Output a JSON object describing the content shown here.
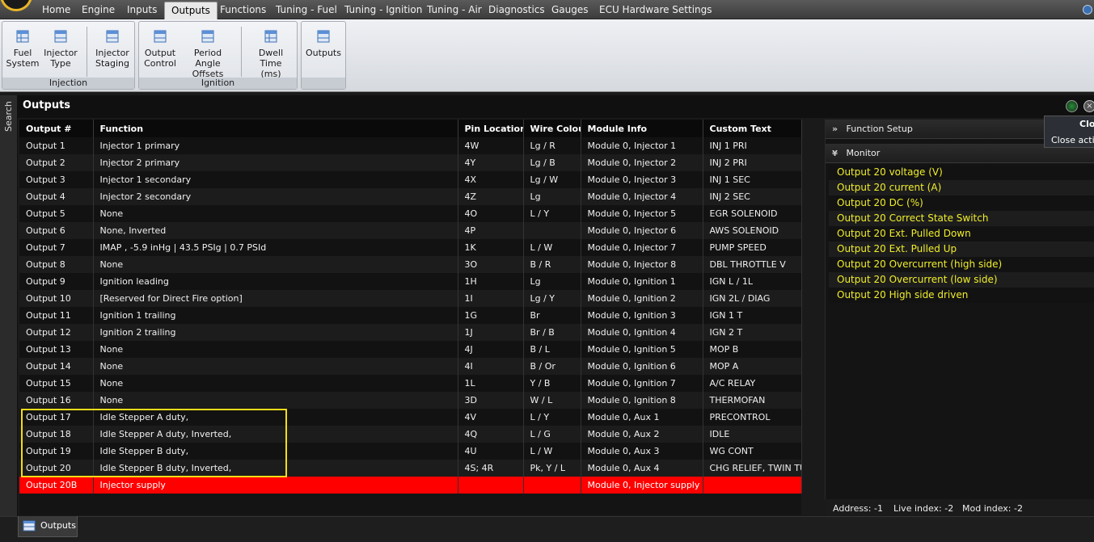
{
  "menu": {
    "items": [
      "Home",
      "Engine",
      "Inputs",
      "Outputs",
      "Functions",
      "Tuning - Fuel",
      "Tuning - Ignition",
      "Tuning - Air",
      "Diagnostics",
      "Gauges",
      "ECU Hardware Settings"
    ],
    "active": "Outputs"
  },
  "ribbon": {
    "injection": {
      "label": "Injection",
      "buttons": [
        {
          "line1": "Fuel",
          "line2": "System"
        },
        {
          "line1": "Injector",
          "line2": "Type"
        },
        {
          "line1": "Injector",
          "line2": "Staging"
        }
      ]
    },
    "ignition": {
      "label": "Ignition",
      "buttons": [
        {
          "line1": "Output",
          "line2": "Control"
        },
        {
          "line1": "Period Angle",
          "line2": "Offsets"
        },
        {
          "line1": "Dwell Time",
          "line2": "(ms)"
        }
      ]
    },
    "outputs": {
      "label": "",
      "button": "Outputs"
    }
  },
  "sidebar": {
    "search_label": "Search"
  },
  "panel": {
    "title": "Outputs"
  },
  "table": {
    "headers": [
      "Output #",
      "Function",
      "Pin Location",
      "Wire Colour",
      "Module Info",
      "Custom Text"
    ],
    "rows": [
      [
        "Output 1",
        "Injector 1 primary",
        "4W",
        "Lg / R",
        "Module 0, Injector 1",
        "INJ 1 PRI"
      ],
      [
        "Output 2",
        "Injector 2 primary",
        "4Y",
        "Lg / B",
        "Module 0, Injector 2",
        "INJ 2 PRI"
      ],
      [
        "Output 3",
        "Injector 1 secondary",
        "4X",
        "Lg / W",
        "Module 0, Injector 3",
        "INJ 1 SEC"
      ],
      [
        "Output 4",
        "Injector 2 secondary",
        "4Z",
        "Lg",
        "Module 0, Injector 4",
        "INJ 2 SEC"
      ],
      [
        "Output 5",
        "None",
        "4O",
        "L / Y",
        "Module 0, Injector 5",
        "EGR SOLENOID"
      ],
      [
        "Output 6",
        "None, Inverted",
        "4P",
        "",
        "Module 0, Injector 6",
        "AWS SOLENOID"
      ],
      [
        "Output 7",
        "IMAP , -5.9 inHg | 43.5 PSIg | 0.7 PSId",
        "1K",
        "L / W",
        "Module 0, Injector 7",
        "PUMP SPEED"
      ],
      [
        "Output 8",
        "None",
        "3O",
        "B / R",
        "Module 0, Injector 8",
        "DBL THROTTLE V"
      ],
      [
        "Output 9",
        "Ignition leading",
        "1H",
        "Lg",
        "Module 0, Ignition 1",
        "IGN L / 1L"
      ],
      [
        "Output 10",
        "[Reserved for Direct Fire option]",
        "1I",
        "Lg / Y",
        "Module 0, Ignition 2",
        "IGN 2L / DIAG"
      ],
      [
        "Output 11",
        "Ignition 1 trailing",
        "1G",
        "Br",
        "Module 0, Ignition 3",
        "IGN 1 T"
      ],
      [
        "Output 12",
        "Ignition 2 trailing",
        "1J",
        "Br / B",
        "Module 0, Ignition 4",
        "IGN 2 T"
      ],
      [
        "Output 13",
        "None",
        "4J",
        "B / L",
        "Module 0, Ignition 5",
        "MOP B"
      ],
      [
        "Output 14",
        "None",
        "4I",
        "B / Or",
        "Module 0, Ignition 6",
        "MOP A"
      ],
      [
        "Output 15",
        "None",
        "1L",
        "Y / B",
        "Module 0, Ignition 7",
        "A/C RELAY"
      ],
      [
        "Output 16",
        "None",
        "3D",
        "W / L",
        "Module 0, Ignition 8",
        "THERMOFAN"
      ],
      [
        "Output 17",
        "Idle Stepper A duty,",
        "4V",
        "L / Y",
        "Module 0, Aux 1",
        "PRECONTROL"
      ],
      [
        "Output 18",
        "Idle Stepper A duty, Inverted,",
        "4Q",
        "L / G",
        "Module 0, Aux 2",
        "IDLE"
      ],
      [
        "Output 19",
        "Idle Stepper B duty,",
        "4U",
        "L / W",
        "Module 0, Aux 3",
        "WG CONT"
      ],
      [
        "Output 20",
        "Idle Stepper B duty, Inverted,",
        "4S; 4R",
        "Pk, Y / L",
        "Module 0, Aux 4",
        "CHG RELIEF, TWIN TURBO"
      ],
      [
        "Output 20B",
        "Injector supply",
        "",
        "",
        "Module 0, Injector supply",
        ""
      ]
    ]
  },
  "right_panel": {
    "function_setup": "Function Setup",
    "monitor": "Monitor",
    "monitor_items": [
      "Output 20 voltage (V)",
      "Output 20 current (A)",
      "Output 20  DC (%)",
      "Output 20 Correct State Switch",
      "Output 20 Ext. Pulled Down",
      "Output 20 Ext. Pulled Up",
      "Output 20  Overcurrent (high side)",
      "Output 20  Overcurrent (low side)",
      "Output 20  High side driven"
    ],
    "tooltip": {
      "title": "Clos",
      "text": "Close activ"
    },
    "address": "Address: -1",
    "live_index": "Live index: -2",
    "mod_index": "Mod index: -2"
  },
  "bottom_tab": {
    "label": "Outputs"
  },
  "colors": {
    "highlight_row": "#ff0000",
    "selection_box": "#f3dc18",
    "monitor_text": "#f1ee2a"
  }
}
